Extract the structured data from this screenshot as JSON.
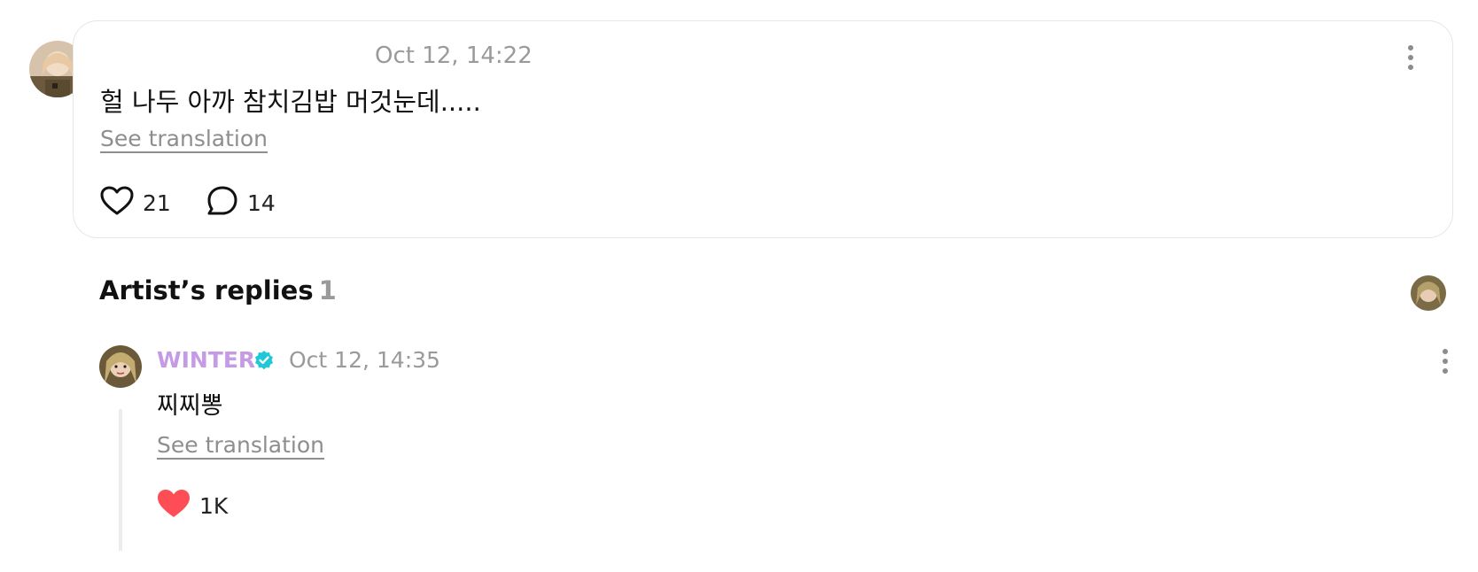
{
  "comment": {
    "timestamp": "Oct 12, 14:22",
    "text": "헐 나두 아까 참치김밥 머것눈데.....",
    "see_translation": "See translation",
    "likes": "21",
    "replies": "14"
  },
  "artist_replies": {
    "title": "Artist’s replies",
    "count": "1"
  },
  "reply": {
    "author": "WINTER",
    "timestamp": "Oct 12, 14:35",
    "text": "찌찌뽕",
    "see_translation": "See translation",
    "likes": "1K"
  },
  "colors": {
    "artist_name": "#c69be6",
    "verified_badge": "#1ec8d8",
    "liked_heart": "#ff4d55",
    "muted_text": "#9a9a9a"
  },
  "icons": {
    "like": "heart-outline-icon",
    "liked": "heart-filled-icon",
    "comment": "speech-bubble-icon",
    "more": "more-vertical-icon",
    "verified": "verified-badge-icon"
  }
}
